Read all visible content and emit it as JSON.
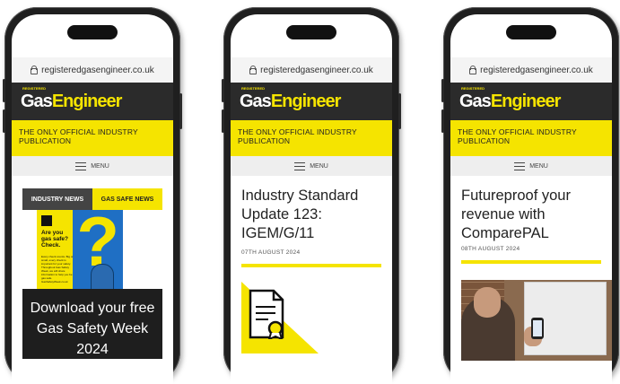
{
  "url": "registeredgasengineer.co.uk",
  "logo": {
    "prefix": "REGISTERED",
    "gas": "Gas",
    "engineer": "Engineer"
  },
  "tagline": "THE ONLY OFFICIAL INDUSTRY PUBLICATION",
  "menu_label": "MENU",
  "phone1": {
    "tabs": [
      "INDUSTRY NEWS",
      "GAS SAFE NEWS"
    ],
    "poster": {
      "heading": "Are you gas safe? Check.",
      "body": "Every check counts. Big or small, every check is important for your safety. Throughout Gas Safety Week, we will share information to help you be gas safe. GasSafetyWeek.co.uk"
    },
    "promo": "Download your free Gas Safety Week 2024"
  },
  "phone2": {
    "headline": "Industry Standard Update 123: IGEM/G/11",
    "date": "07TH AUGUST 2024"
  },
  "phone3": {
    "headline": "Futureproof your revenue with ComparePAL",
    "date": "08TH AUGUST 2024"
  },
  "colors": {
    "brand_yellow": "#f5e400",
    "header_dark": "#2b2b2b",
    "poster_blue": "#1f6fc4"
  }
}
